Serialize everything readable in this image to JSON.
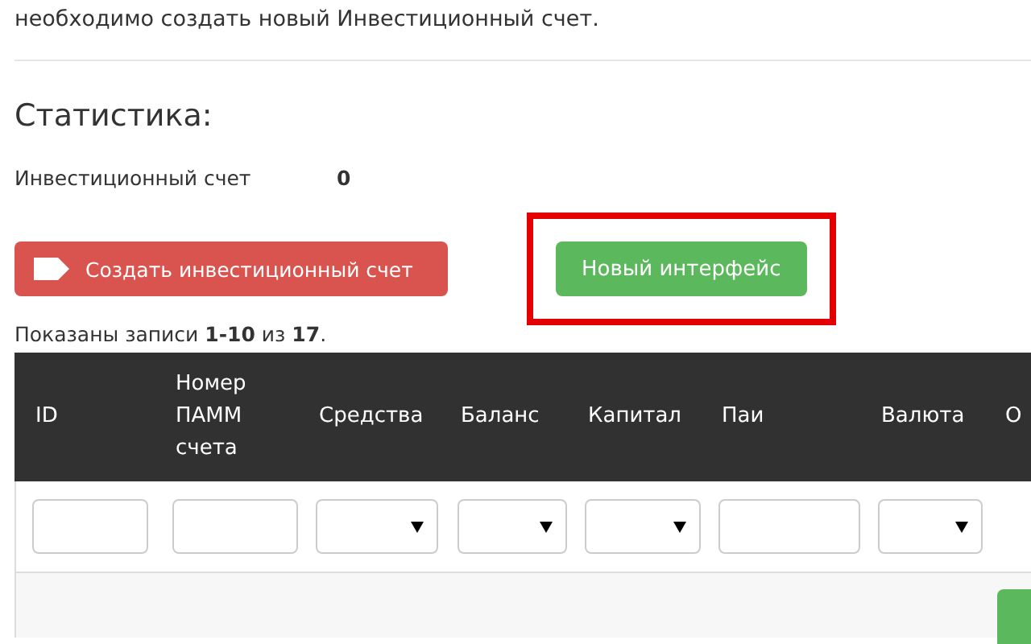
{
  "intro": "необходимо создать новый Инвестиционный счет.",
  "heading": "Статистика:",
  "stats": [
    {
      "label": "Инвестиционный счет",
      "value": "0"
    }
  ],
  "buttons": [
    {
      "kind": "danger",
      "label": "Создать инвестиционный счет",
      "highlighted": false
    },
    {
      "kind": "success",
      "label": "Новый интерфейс",
      "highlighted": true
    }
  ],
  "summary": "Показаны записи **1-10** из **17**.",
  "table": {
    "columns": [
      "ID",
      "Номер ПАММ счета",
      "Средства",
      "Баланс",
      "Капитал",
      "Паи",
      "Валюта",
      "О"
    ],
    "filters": [
      {
        "kind": "input"
      },
      {
        "kind": "input"
      },
      {
        "kind": "select"
      },
      {
        "kind": "select"
      },
      {
        "kind": "select"
      },
      {
        "kind": "input"
      },
      {
        "kind": "select"
      }
    ]
  }
}
